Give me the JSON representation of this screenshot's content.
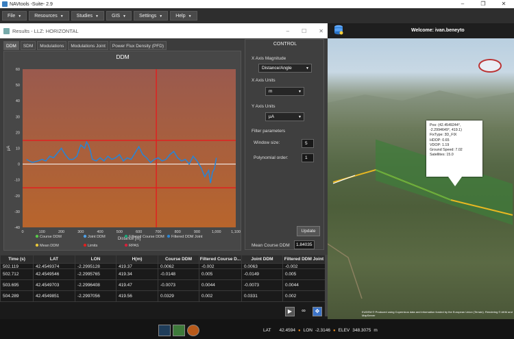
{
  "app": {
    "title": "NAVtools -Suite- 2.9",
    "window_controls": [
      "–",
      "❐",
      "✕"
    ]
  },
  "menubar": {
    "items": [
      "File",
      "Resources",
      "Studies",
      "GIS",
      "Settings",
      "Help"
    ]
  },
  "header": {
    "welcome_label": "Welcome:",
    "user": "ivan.beneyto"
  },
  "results": {
    "title": "Results - LLZ: HORIZONTAL",
    "tabs": [
      "DDM",
      "SDM",
      "Modulations",
      "Modulations Joint",
      "Power Flux Density (PFD)"
    ],
    "active_tab": "DDM"
  },
  "chart_data": {
    "type": "line",
    "title": "DDM",
    "xlabel": "Distance [m]",
    "ylabel": "µA",
    "xlim": [
      0,
      1100
    ],
    "ylim": [
      -40,
      60
    ],
    "xticks": [
      "0",
      "100",
      "200",
      "300",
      "400",
      "500",
      "600",
      "700",
      "800",
      "900",
      "1,000",
      "1,100"
    ],
    "yticks": [
      "60",
      "50",
      "40",
      "30",
      "20",
      "10",
      "0",
      "-10",
      "-20",
      "-30",
      "-40"
    ],
    "limits": {
      "upper": 15,
      "lower": -15
    },
    "zero_line": 0,
    "vertical_marker_x": 690,
    "series": [
      {
        "name": "Filtered DDM Joint",
        "color": "#2a84d2",
        "x": [
          20,
          50,
          80,
          100,
          120,
          140,
          160,
          180,
          200,
          220,
          240,
          260,
          280,
          300,
          320,
          330,
          340,
          350,
          360,
          380,
          400,
          420,
          440,
          460,
          480,
          500,
          520,
          540,
          560,
          580,
          600,
          620,
          640,
          660,
          680,
          700,
          720,
          740,
          760,
          780,
          800,
          820,
          840,
          860,
          880,
          900,
          920,
          940,
          960,
          970,
          980,
          990,
          1000
        ],
        "y": [
          3,
          1,
          2,
          3,
          2,
          5,
          4,
          7,
          10,
          6,
          3,
          3,
          5,
          12,
          10,
          14,
          12,
          8,
          3,
          2,
          4,
          2,
          5,
          3,
          4,
          6,
          2,
          4,
          3,
          7,
          11,
          6,
          4,
          1,
          3,
          4,
          2,
          3,
          6,
          8,
          4,
          2,
          3,
          0,
          5,
          2,
          -2,
          -8,
          -4,
          -12,
          -5,
          -3,
          4
        ]
      }
    ],
    "legend": [
      {
        "label": "Course DDM",
        "color": "#58c94a"
      },
      {
        "label": "Joint DDM",
        "color": "#4fa0e6"
      },
      {
        "label": "Filtered Course DDM",
        "color": "#1ca87a"
      },
      {
        "label": "Filtered DDM Joint",
        "color": "#2a84d2"
      },
      {
        "label": "Mean DDM",
        "color": "#e6c63a"
      },
      {
        "label": "Limits",
        "color": "#e02020"
      },
      {
        "label": "RPAS",
        "color": "#d8203a"
      }
    ],
    "colors": {
      "plot_bg_top": "#9a5a4e",
      "plot_bg_bottom": "#b8652c",
      "limits": "#e02020",
      "marker": "#e02020",
      "zero": "#ffffff"
    }
  },
  "control": {
    "title": "CONTROL",
    "x_magnitude_label": "X Axis Magnitude",
    "x_magnitude_value": "Distance/Angle",
    "x_units_label": "X Axis Units",
    "x_units_value": "m",
    "y_units_label": "Y Axis Units",
    "y_units_value": "µA",
    "filter_label": "Filter parameters",
    "window_size_label": "Window size:",
    "window_size_value": "5",
    "poly_order_label": "Polynomial order:",
    "poly_order_value": "1",
    "update_label": "Update",
    "mean_label": "Mean Course DDM",
    "mean_value": "1.84035"
  },
  "table": {
    "columns": [
      "Time (s)",
      "LAT",
      "LON",
      "H(m)",
      "Course DDM",
      "Filtered Course D...",
      "Joint DDM",
      "Filtered DDM Joint"
    ],
    "rows": [
      [
        "502.119",
        "42.4549374",
        "-2.2995128",
        "419.37",
        "0.0062",
        "-0.002",
        "0.0063",
        "-0.002"
      ],
      [
        "502.712",
        "42.4549546",
        "-2.2995765",
        "419.34",
        "-0.0148",
        "0.005",
        "-0.0149",
        "0.005"
      ],
      [
        "503.695",
        "42.4549703",
        "-2.2996408",
        "419.47",
        "-0.0073",
        "0.0044",
        "-0.0073",
        "0.0044"
      ],
      [
        "504.289",
        "42.4549851",
        "-2.2997056",
        "419.56",
        "0.0329",
        "0.002",
        "0.0331",
        "0.002"
      ]
    ]
  },
  "map": {
    "popup_lines": [
      "Pos: (42.4549244°,",
      "-2.2994649°, 419.1)",
      "FixType: 3D_FIX",
      "HDOP: 0.65",
      "VDOP: 1.19",
      "Ground Speed: 7.02",
      "Satellites: 15.0"
    ],
    "credit": "EUDEM © Produced using Copernicus data and information funded by the European Union (Terrain). Rendering © AKM and MapServer"
  },
  "statusbar": {
    "lat_label": "LAT",
    "lat_value": "42.4594",
    "lon_label": "LON",
    "lon_value": "-2.3146",
    "elev_label": "ELEV",
    "elev_value": "348.3075",
    "elev_unit": "m"
  }
}
